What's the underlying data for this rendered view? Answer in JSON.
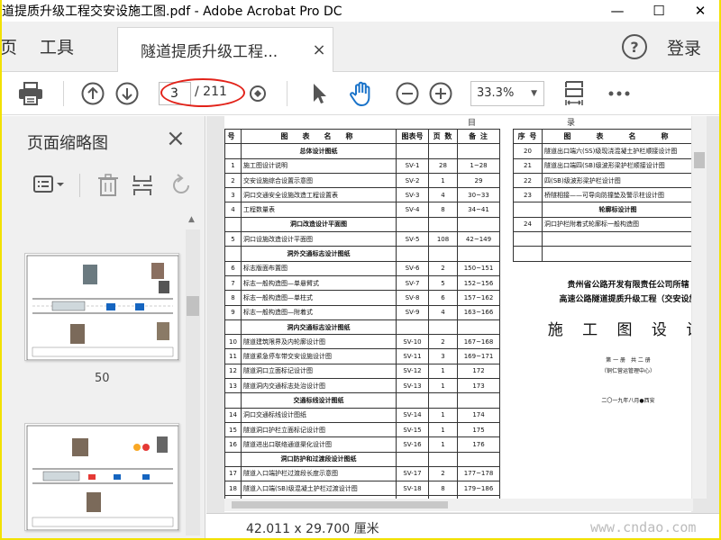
{
  "window": {
    "title": "道提质升级工程交安设施工图.pdf - Adobe Acrobat Pro DC",
    "controls": {
      "minimize": "—",
      "maximize": "☐",
      "close": "✕"
    }
  },
  "tabbar": {
    "home_label": "页",
    "tools_label": "工具",
    "document_tab": "隧道提质升级工程...",
    "document_tab_close": "×",
    "help": "?",
    "login": "登录"
  },
  "toolbar": {
    "current_page": "3",
    "total_pages": "/ 211",
    "zoom": "33.3%",
    "annotation_color": "#e2231a"
  },
  "sidebar": {
    "title": "页面缩略图",
    "close": "×",
    "thumbnails": [
      {
        "label": "50"
      }
    ]
  },
  "document": {
    "left_table": {
      "headers": [
        "号",
        "图　表　名　称",
        "图表号",
        "页 数",
        "备 注"
      ],
      "rows": [
        {
          "type": "section",
          "name": "总体设计图纸"
        },
        {
          "no": "1",
          "name": "施工图设计说明",
          "code": "SV-1",
          "pages": "28",
          "note": "1~28"
        },
        {
          "no": "2",
          "name": "交安设施综合设置示意图",
          "code": "SV-2",
          "pages": "1",
          "note": "29"
        },
        {
          "no": "3",
          "name": "洞口交通安全设施改造工程设置表",
          "code": "SV-3",
          "pages": "4",
          "note": "30~33"
        },
        {
          "no": "4",
          "name": "工程数量表",
          "code": "SV-4",
          "pages": "8",
          "note": "34~41"
        },
        {
          "type": "section",
          "name": "洞口改造设计平面图"
        },
        {
          "no": "5",
          "name": "洞口设施改造设计平面图",
          "code": "SV-5",
          "pages": "108",
          "note": "42~149"
        },
        {
          "type": "section",
          "name": "洞外交通标志设计图纸"
        },
        {
          "no": "6",
          "name": "标志版面布置图",
          "code": "SV-6",
          "pages": "2",
          "note": "150~151"
        },
        {
          "no": "7",
          "name": "标志一般构造图—单悬臂式",
          "code": "SV-7",
          "pages": "5",
          "note": "152~156"
        },
        {
          "no": "8",
          "name": "标志一般构造图—单柱式",
          "code": "SV-8",
          "pages": "6",
          "note": "157~162"
        },
        {
          "no": "9",
          "name": "标志一般构造图—附着式",
          "code": "SV-9",
          "pages": "4",
          "note": "163~166"
        },
        {
          "type": "section",
          "name": "洞内交通标志设计图纸"
        },
        {
          "no": "10",
          "name": "隧道建筑限界及内轮廓设计图",
          "code": "SV-10",
          "pages": "2",
          "note": "167~168"
        },
        {
          "no": "11",
          "name": "隧道紧急停车带交安设施设计图",
          "code": "SV-11",
          "pages": "3",
          "note": "169~171"
        },
        {
          "no": "12",
          "name": "隧道洞口立面标记设计图",
          "code": "SV-12",
          "pages": "1",
          "note": "172"
        },
        {
          "no": "13",
          "name": "隧道洞内交通标志处治设计图",
          "code": "SV-13",
          "pages": "1",
          "note": "173"
        },
        {
          "type": "section",
          "name": "交通标线设计图纸"
        },
        {
          "no": "14",
          "name": "洞口交通标线设计图纸",
          "code": "SV-14",
          "pages": "1",
          "note": "174"
        },
        {
          "no": "15",
          "name": "隧道洞口护栏立面标记设计图",
          "code": "SV-15",
          "pages": "1",
          "note": "175"
        },
        {
          "no": "16",
          "name": "隧道进出口联络通道渠化设计图",
          "code": "SV-16",
          "pages": "1",
          "note": "176"
        },
        {
          "type": "section",
          "name": "洞口防护和过渡段设计图纸"
        },
        {
          "no": "17",
          "name": "隧道入口端护栏过渡段长度示意图",
          "code": "SV-17",
          "pages": "2",
          "note": "177~178"
        },
        {
          "no": "18",
          "name": "隧道入口端(SB)级混凝土护栏过渡设计图",
          "code": "SV-18",
          "pages": "8",
          "note": "179~186"
        },
        {
          "no": "19",
          "name": "隧道入口端四(SB)级波形梁护栏过渡设计图",
          "code": "SV-19",
          "pages": "4",
          "note": "187~190"
        }
      ]
    },
    "right_table": {
      "headers": [
        "序 号",
        "图　　表　　名　　称"
      ],
      "rows": [
        {
          "no": "20",
          "name": "隧道出口端六(SS)级现浇混凝土护栏顺接设计图"
        },
        {
          "no": "21",
          "name": "隧道出口端四(SB)级波形梁护栏顺接设计图"
        },
        {
          "no": "22",
          "name": "四(SB)级波形梁护栏设计图"
        },
        {
          "no": "23",
          "name": "桥隧相接——可导向防撞垫及警示柱设计图"
        },
        {
          "type": "section",
          "name": "轮廓标设计图"
        },
        {
          "no": "24",
          "name": "洞口护栏附着式轮廓标一般构造图"
        },
        {
          "no": "",
          "name": ""
        },
        {
          "no": "",
          "name": ""
        }
      ]
    },
    "cover": {
      "org": "贵州省公路开发有限责任公司所辖",
      "project": "高速公路隧道提质升级工程（交安设施",
      "big_title": "施 工 图 设 计",
      "volume": "第 一 册　共 二 册",
      "sub": "（铜仁营运管理中心）",
      "date": "二〇一九年八月●西安"
    }
  },
  "status": {
    "dimensions": "42.011 x 29.700 厘米",
    "watermark": "www.cndao.com"
  }
}
